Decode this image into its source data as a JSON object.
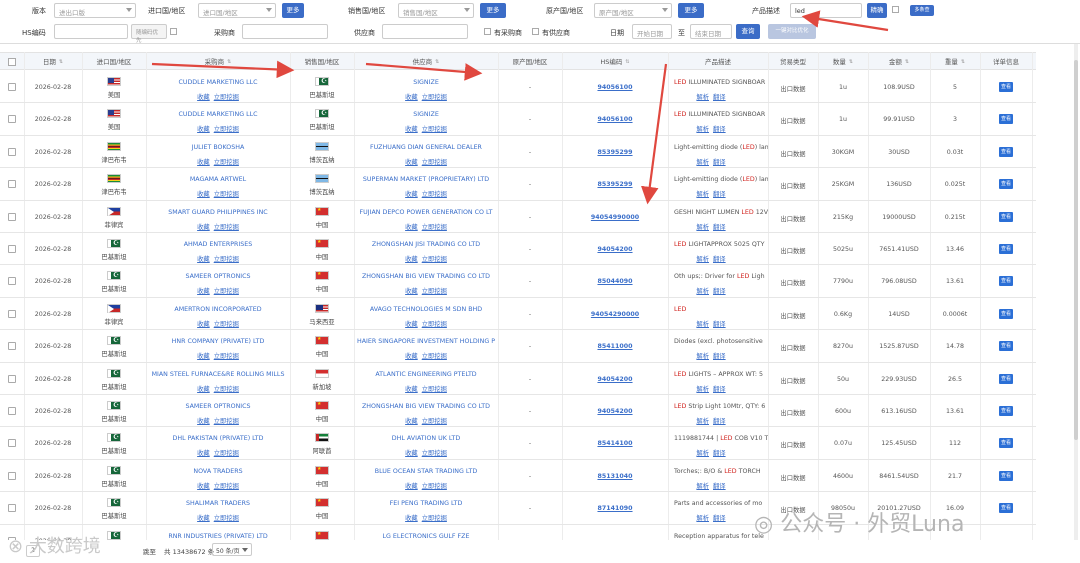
{
  "filters": {
    "version_label": "版本",
    "version_value": "进出口版",
    "import_country_label": "进口国/地区",
    "import_country_placeholder": "进口国/地区",
    "more1": "更多",
    "sales_country_label": "销售国/地区",
    "sales_country_placeholder": "销售国/地区",
    "more2": "更多",
    "origin_country_label": "原产国/地区",
    "origin_country_placeholder": "原产国/地区",
    "more3": "更多",
    "product_label": "产品描述",
    "product_value": "led",
    "exact_label": "精确",
    "multi_search": "多条查",
    "hs_label": "HS编码",
    "hs_placeholder": "",
    "hs_first": "随编码优先",
    "buyer_label": "采购商",
    "supplier_label": "供应商",
    "has_buyer": "有采购商",
    "has_supplier": "有供应商",
    "date_label": "日期",
    "date_start": "开始日期",
    "date_sep": "至",
    "date_end": "结束日期",
    "query_button": "查询",
    "export_button": "一键对比优化"
  },
  "table": {
    "headers": [
      "日期",
      "进口国/地区",
      "采购商",
      "销售国/地区",
      "供应商",
      "原产国/地区",
      "HS编码",
      "产品描述",
      "贸易类型",
      "数量",
      "金额",
      "重量",
      "详单信息"
    ],
    "action_collect": "收藏",
    "action_contact": "立即挖掘",
    "action_parse": "解析",
    "action_translate": "翻译",
    "detail_label": "查看",
    "rows": [
      {
        "date": "2026-02-28",
        "imp_flag": "us",
        "imp": "美国",
        "buyer": "CUDDLE MARKETING LLC",
        "sale_flag": "pk",
        "sale": "巴基斯坦",
        "supplier": "SIGNIZE",
        "origin": "-",
        "hs": "94056100",
        "desc_pre": "",
        "desc_hl": "LED",
        "desc_post": " ILLUMINATED SIGNBOAR",
        "trade": "出口数据",
        "qty": "1u",
        "amount": "108.9USD",
        "weight": "5"
      },
      {
        "date": "2026-02-28",
        "imp_flag": "us",
        "imp": "美国",
        "buyer": "CUDDLE MARKETING LLC",
        "sale_flag": "pk",
        "sale": "巴基斯坦",
        "supplier": "SIGNIZE",
        "origin": "-",
        "hs": "94056100",
        "desc_pre": "",
        "desc_hl": "LED",
        "desc_post": " ILLUMINATED SIGNBOAR",
        "trade": "出口数据",
        "qty": "1u",
        "amount": "99.91USD",
        "weight": "3"
      },
      {
        "date": "2026-02-28",
        "imp_flag": "zw",
        "imp": "津巴布韦",
        "buyer": "JULIET BOKOSHA",
        "sale_flag": "bw",
        "sale": "博茨瓦纳",
        "supplier": "FUZHUANG DIAN GENERAL DEALER",
        "origin": "-",
        "hs": "85395299",
        "desc_pre": "Light-emitting diode (",
        "desc_hl": "LED",
        "desc_post": ") lam",
        "trade": "出口数据",
        "qty": "30KGM",
        "amount": "30USD",
        "weight": "0.03t"
      },
      {
        "date": "2026-02-28",
        "imp_flag": "zw",
        "imp": "津巴布韦",
        "buyer": "MAGAMA ARTWEL",
        "sale_flag": "bw",
        "sale": "博茨瓦纳",
        "supplier": "SUPERMAN MARKET (PROPRIETARY) LTD",
        "origin": "-",
        "hs": "85395299",
        "desc_pre": "Light-emitting diode (",
        "desc_hl": "LED",
        "desc_post": ") lam",
        "trade": "出口数据",
        "qty": "25KGM",
        "amount": "136USD",
        "weight": "0.025t"
      },
      {
        "date": "2026-02-28",
        "imp_flag": "ph",
        "imp": "菲律宾",
        "buyer": "SMART GUARD PHILIPPINES INC",
        "sale_flag": "cn",
        "sale": "中国",
        "supplier": "FUJIAN DEPCO POWER GENERATION CO LT",
        "origin": "-",
        "hs": "94054990000",
        "desc_pre": "GESHI NIGHT LUMEN ",
        "desc_hl": "LED",
        "desc_post": " 12V",
        "trade": "出口数据",
        "qty": "215Kg",
        "amount": "19000USD",
        "weight": "0.215t"
      },
      {
        "date": "2026-02-28",
        "imp_flag": "pk",
        "imp": "巴基斯坦",
        "buyer": "AHMAD ENTERPRISES",
        "sale_flag": "cn",
        "sale": "中国",
        "supplier": "ZHONGSHAN JISI TRADING CO LTD",
        "origin": "-",
        "hs": "94054200",
        "desc_pre": "",
        "desc_hl": "LED",
        "desc_post": " LIGHTAPPROX 5025 QTY",
        "trade": "出口数据",
        "qty": "5025u",
        "amount": "7651.41USD",
        "weight": "13.46"
      },
      {
        "date": "2026-02-28",
        "imp_flag": "pk",
        "imp": "巴基斯坦",
        "buyer": "SAMEER OPTRONICS",
        "sale_flag": "cn",
        "sale": "中国",
        "supplier": "ZHONGSHAN BIG VIEW TRADING CO LTD",
        "origin": "-",
        "hs": "85044090",
        "desc_pre": "Oth ups;: Driver for ",
        "desc_hl": "LED",
        "desc_post": " Ligh",
        "trade": "出口数据",
        "qty": "7790u",
        "amount": "796.08USD",
        "weight": "13.61"
      },
      {
        "date": "2026-02-28",
        "imp_flag": "ph",
        "imp": "菲律宾",
        "buyer": "AMERTRON INCORPORATED",
        "sale_flag": "my",
        "sale": "马来西亚",
        "supplier": "AVAGO TECHNOLOGIES M SDN BHD",
        "origin": "-",
        "hs": "94054290000",
        "desc_pre": "",
        "desc_hl": "LED",
        "desc_post": "",
        "trade": "出口数据",
        "qty": "0.6Kg",
        "amount": "14USD",
        "weight": "0.0006t"
      },
      {
        "date": "2026-02-28",
        "imp_flag": "pk",
        "imp": "巴基斯坦",
        "buyer": "HNR COMPANY (PRIVATE) LTD",
        "sale_flag": "cn",
        "sale": "中国",
        "supplier": "HAIER SINGAPORE INVESTMENT HOLDING P",
        "origin": "-",
        "hs": "85411000",
        "desc_pre": "Diodes (excl. photosensitive",
        "desc_hl": "",
        "desc_post": "",
        "trade": "出口数据",
        "qty": "8270u",
        "amount": "1525.87USD",
        "weight": "14.78"
      },
      {
        "date": "2026-02-28",
        "imp_flag": "pk",
        "imp": "巴基斯坦",
        "buyer": "MIAN STEEL FURNACE&RE ROLLING MILLS",
        "sale_flag": "sg",
        "sale": "新加坡",
        "supplier": "ATLANTIC ENGINEERING PTELTD",
        "origin": "-",
        "hs": "94054200",
        "desc_pre": "",
        "desc_hl": "LED",
        "desc_post": " LIGHTS – APPROX WT: 5",
        "trade": "出口数据",
        "qty": "50u",
        "amount": "229.93USD",
        "weight": "26.5"
      },
      {
        "date": "2026-02-28",
        "imp_flag": "pk",
        "imp": "巴基斯坦",
        "buyer": "SAMEER OPTRONICS",
        "sale_flag": "cn",
        "sale": "中国",
        "supplier": "ZHONGSHAN BIG VIEW TRADING CO LTD",
        "origin": "-",
        "hs": "94054200",
        "desc_pre": "",
        "desc_hl": "LED",
        "desc_post": " Strip Light 10Mtr, QTY: 6",
        "trade": "出口数据",
        "qty": "600u",
        "amount": "613.16USD",
        "weight": "13.61"
      },
      {
        "date": "2026-02-28",
        "imp_flag": "pk",
        "imp": "巴基斯坦",
        "buyer": "DHL PAKISTAN (PRIVATE) LTD",
        "sale_flag": "ae",
        "sale": "阿联酋",
        "supplier": "DHL AVIATION UK LTD",
        "origin": "-",
        "hs": "85414100",
        "desc_pre": "1119881744 | ",
        "desc_hl": "LED",
        "desc_post": " COB V10 T",
        "trade": "出口数据",
        "qty": "0.07u",
        "amount": "125.45USD",
        "weight": "112"
      },
      {
        "date": "2026-02-28",
        "imp_flag": "pk",
        "imp": "巴基斯坦",
        "buyer": "NOVA TRADERS",
        "sale_flag": "cn",
        "sale": "中国",
        "supplier": "BLUE OCEAN STAR TRADING LTD",
        "origin": "-",
        "hs": "85131040",
        "desc_pre": "Torches;: B/O & ",
        "desc_hl": "LED",
        "desc_post": " TORCH",
        "trade": "出口数据",
        "qty": "4600u",
        "amount": "8461.54USD",
        "weight": "21.7"
      },
      {
        "date": "2026-02-28",
        "imp_flag": "pk",
        "imp": "巴基斯坦",
        "buyer": "SHALIMAR TRADERS",
        "sale_flag": "cn",
        "sale": "中国",
        "supplier": "FEI PENG TRADING LTD",
        "origin": "-",
        "hs": "87141090",
        "desc_pre": "Parts and accessories of mo",
        "desc_hl": "",
        "desc_post": "",
        "trade": "出口数据",
        "qty": "98050u",
        "amount": "20101.27USD",
        "weight": "16.09"
      },
      {
        "date": "2026-02-28",
        "imp_flag": "pk",
        "imp": "巴基斯坦",
        "buyer": "RNR INDUSTRIES (PRIVATE) LTD",
        "sale_flag": "cn",
        "sale": "中国",
        "supplier": "LG ELECTRONICS GULF FZE",
        "origin": "-",
        "hs": "",
        "desc_pre": "Reception apparatus for tele",
        "desc_hl": "",
        "desc_post": "",
        "trade": "",
        "qty": "",
        "amount": "",
        "weight": ""
      }
    ]
  },
  "footer": {
    "goto": "跳至",
    "total": "共 13438672 条",
    "per_page": "50 条/页",
    "watermark_left": "大数跨境",
    "watermark_right": "公众号 · 外贸Luna"
  },
  "colors": {
    "accent": "#3b6cc7",
    "highlight": "#d0211c",
    "arrow": "#e0483f"
  }
}
